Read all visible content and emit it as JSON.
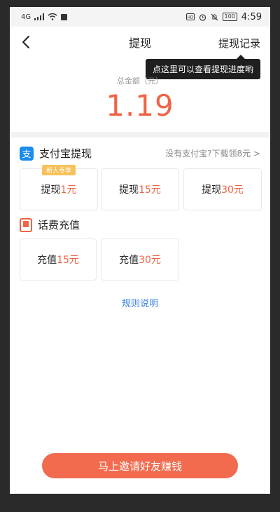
{
  "status": {
    "signal": "4G",
    "time": "4:59",
    "battery": "100"
  },
  "nav": {
    "title": "提现",
    "record": "提现记录"
  },
  "tooltip": "点这里可以查看提现进度哟",
  "total": {
    "label": "总金额（元）",
    "amount": "1.19"
  },
  "alipay": {
    "title": "支付宝提现",
    "link": "没有支付宝?下载领8元 >",
    "icon": "alipay-icon",
    "cards": [
      {
        "prefix": "提现",
        "amount": "1元",
        "badge": "新人专享"
      },
      {
        "prefix": "提现",
        "amount": "15元"
      },
      {
        "prefix": "提现",
        "amount": "30元"
      }
    ]
  },
  "phone_recharge": {
    "title": "话费充值",
    "icon": "phone-icon",
    "cards": [
      {
        "prefix": "充值",
        "amount": "15元"
      },
      {
        "prefix": "充值",
        "amount": "30元"
      }
    ]
  },
  "rules": "规则说明",
  "invite_button": "马上邀请好友赚钱",
  "colors": {
    "accent": "#ef6445",
    "link": "#3b83e0",
    "alipay": "#1a8cf0",
    "badge": "#f7c15a"
  }
}
